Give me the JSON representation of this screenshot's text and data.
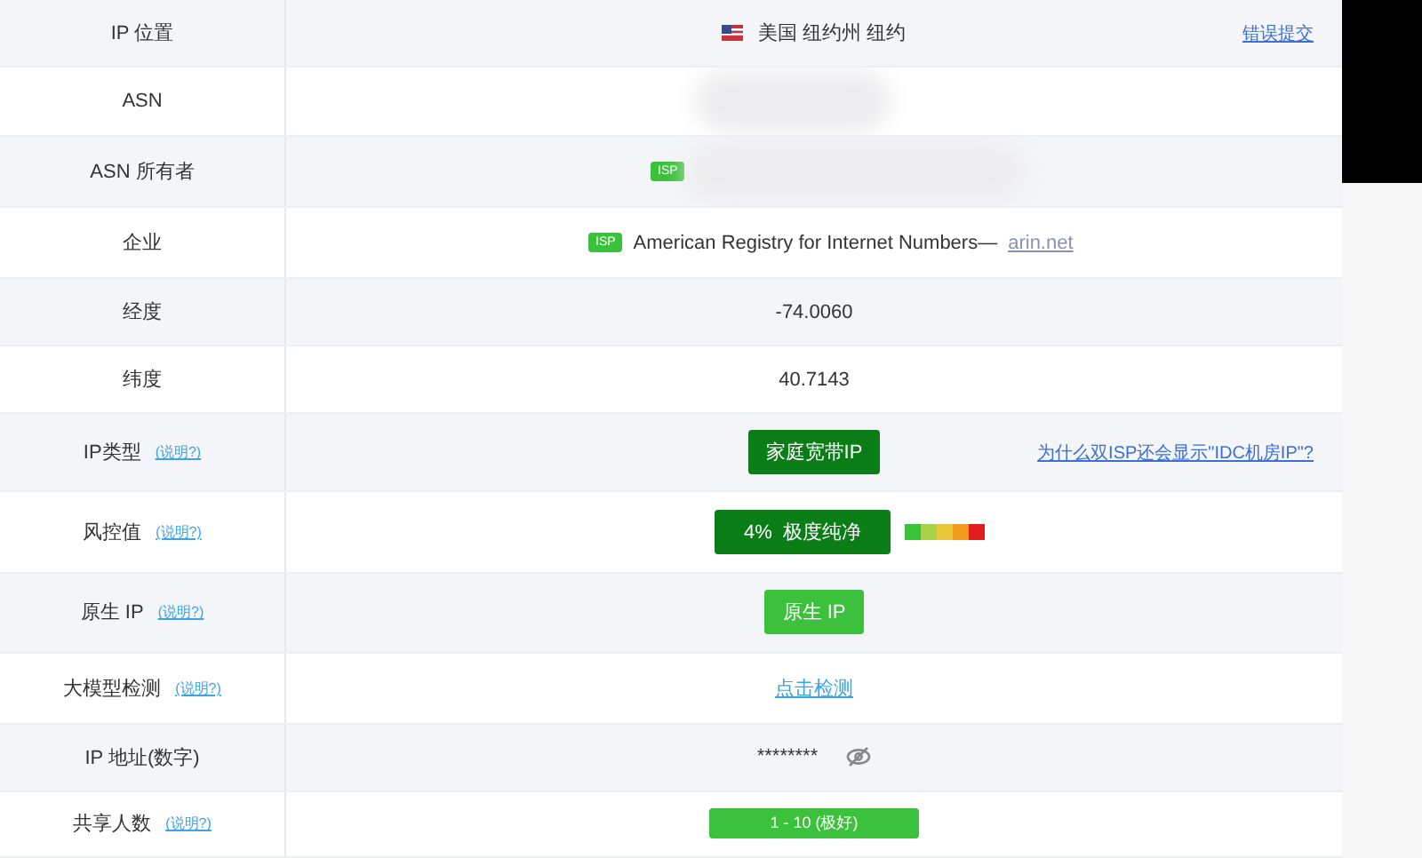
{
  "rows": [
    {
      "label": "IP 位置",
      "kind": "location",
      "value": "美国 纽约州 纽约",
      "side_link": "错误提交"
    },
    {
      "label": "ASN",
      "kind": "redacted"
    },
    {
      "label": "ASN 所有者",
      "kind": "tag",
      "tag": "ISP",
      "redacted": true
    },
    {
      "label": "企业",
      "kind": "tag",
      "tag": "ISP",
      "value": "American Registry for Internet Numbers—",
      "link": "arin.net"
    },
    {
      "label": "经度",
      "kind": "text",
      "value": "-74.0060"
    },
    {
      "label": "纬度",
      "kind": "text",
      "value": "40.7143"
    },
    {
      "label": "IP类型",
      "help": "(说明?)",
      "kind": "badge",
      "value": "家庭宽带IP",
      "color": "#0a7d16",
      "side_link": "为什么双ISP还会显示\"IDC机房IP\"?"
    },
    {
      "label": "风控值",
      "help": "(说明?)",
      "kind": "risk",
      "value": "4%  极度纯净",
      "color": "#0a7d16"
    },
    {
      "label": "原生 IP",
      "help": "(说明?)",
      "kind": "badge",
      "value": "原生 IP",
      "color": "#3cc13c"
    },
    {
      "label": "大模型检测",
      "help": "(说明?)",
      "kind": "link",
      "value": "点击检测"
    },
    {
      "label": "IP 地址(数字)",
      "kind": "masked",
      "value": "********"
    },
    {
      "label": "共享人数",
      "help": "(说明?)",
      "kind": "wide",
      "value": "1 - 10 (极好)",
      "color": "#3cc13c"
    }
  ]
}
